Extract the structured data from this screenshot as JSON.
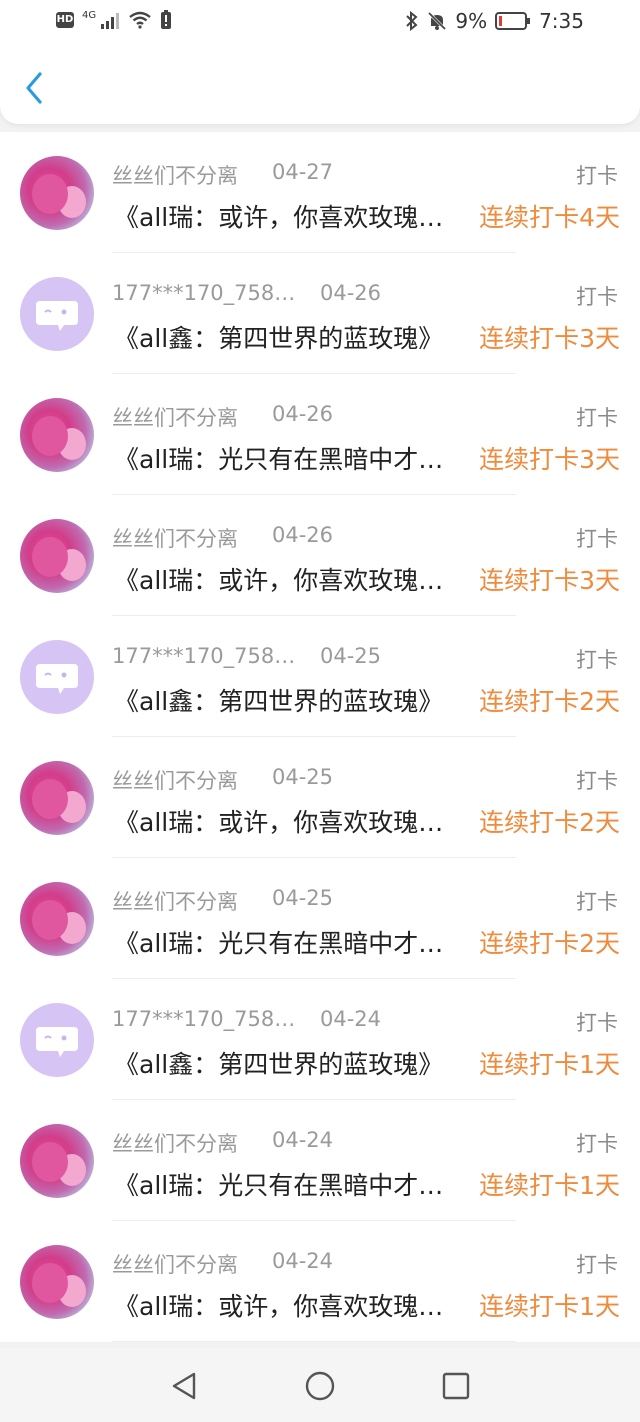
{
  "status_bar": {
    "hd": "HD",
    "network": "4G",
    "battery_percent": "9%",
    "time": "7:35",
    "icons": [
      "signal-icon",
      "wifi-icon",
      "alert-battery-icon",
      "bluetooth-icon",
      "mute-icon",
      "battery-icon"
    ]
  },
  "nav": {
    "back_icon": "chevron-left-icon"
  },
  "rows": [
    {
      "user": "丝丝们不分离",
      "date": "04-27",
      "action": "打卡",
      "title": "《all瑞：或许，你喜欢玫瑰…",
      "streak": "连续打卡4天",
      "avatar": "bear"
    },
    {
      "user": "177***170_758…",
      "date": "04-26",
      "action": "打卡",
      "title": "《all鑫：第四世界的蓝玫瑰》",
      "streak": "连续打卡3天",
      "avatar": "default"
    },
    {
      "user": "丝丝们不分离",
      "date": "04-26",
      "action": "打卡",
      "title": "《all瑞：光只有在黑暗中才…",
      "streak": "连续打卡3天",
      "avatar": "bear"
    },
    {
      "user": "丝丝们不分离",
      "date": "04-26",
      "action": "打卡",
      "title": "《all瑞：或许，你喜欢玫瑰…",
      "streak": "连续打卡3天",
      "avatar": "bear"
    },
    {
      "user": "177***170_758…",
      "date": "04-25",
      "action": "打卡",
      "title": "《all鑫：第四世界的蓝玫瑰》",
      "streak": "连续打卡2天",
      "avatar": "default"
    },
    {
      "user": "丝丝们不分离",
      "date": "04-25",
      "action": "打卡",
      "title": "《all瑞：或许，你喜欢玫瑰…",
      "streak": "连续打卡2天",
      "avatar": "bear"
    },
    {
      "user": "丝丝们不分离",
      "date": "04-25",
      "action": "打卡",
      "title": "《all瑞：光只有在黑暗中才…",
      "streak": "连续打卡2天",
      "avatar": "bear"
    },
    {
      "user": "177***170_758…",
      "date": "04-24",
      "action": "打卡",
      "title": "《all鑫：第四世界的蓝玫瑰》",
      "streak": "连续打卡1天",
      "avatar": "default"
    },
    {
      "user": "丝丝们不分离",
      "date": "04-24",
      "action": "打卡",
      "title": "《all瑞：光只有在黑暗中才…",
      "streak": "连续打卡1天",
      "avatar": "bear"
    },
    {
      "user": "丝丝们不分离",
      "date": "04-24",
      "action": "打卡",
      "title": "《all瑞：或许，你喜欢玫瑰…",
      "streak": "连续打卡1天",
      "avatar": "bear"
    }
  ],
  "colors": {
    "accent_blue": "#2b9be0",
    "streak_orange": "#f08a3c",
    "meta_gray": "#9a9a9a",
    "default_avatar_purple": "#d6c4f5"
  },
  "system_nav": [
    "back-triangle-icon",
    "home-circle-icon",
    "recents-square-icon"
  ]
}
